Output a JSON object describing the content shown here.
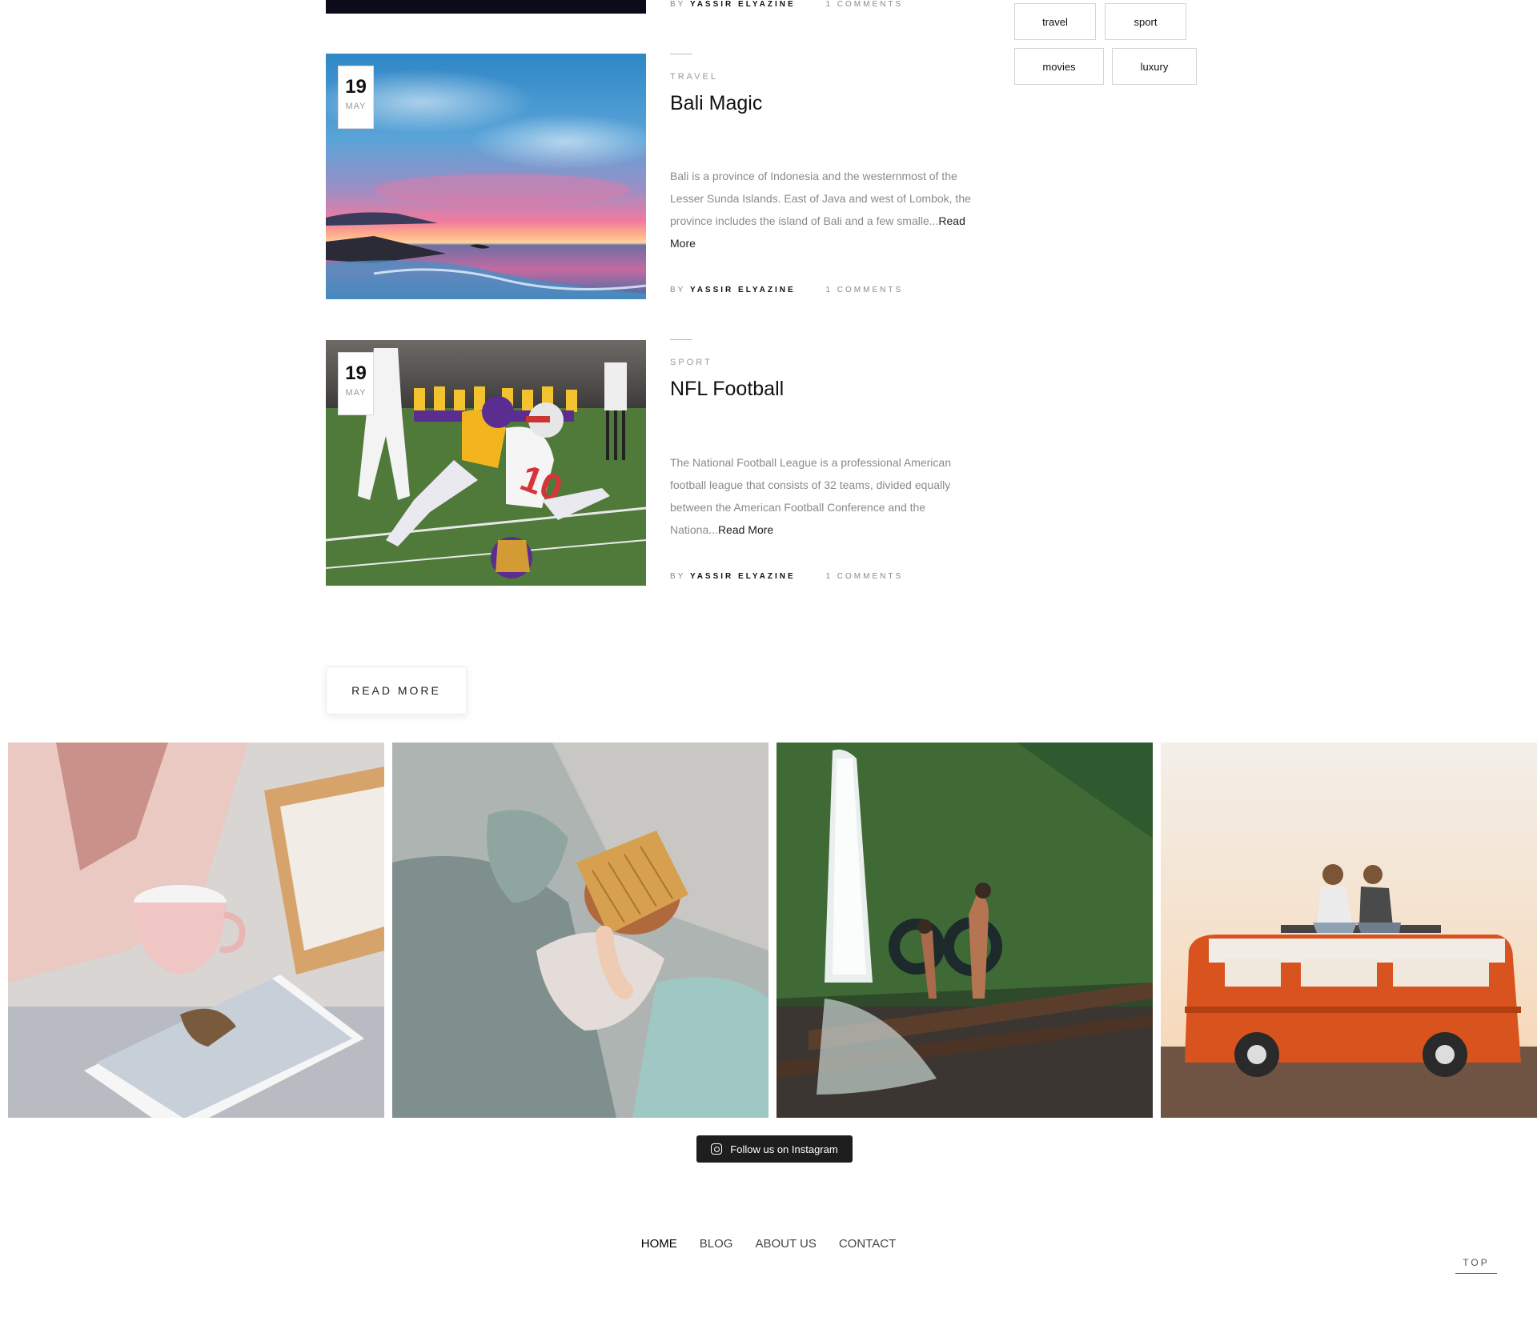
{
  "previous_post": {
    "by": "BY",
    "author": "YASSIR ELYAZINE",
    "comments": "1 COMMENTS"
  },
  "tags": [
    "travel",
    "sport",
    "movies",
    "luxury"
  ],
  "posts": [
    {
      "day": "19",
      "month": "MAY",
      "category": "TRAVEL",
      "title": "Bali Magic",
      "excerpt": "Bali is a province of Indonesia and the westernmost of the Lesser Sunda Islands. East of Java and west of Lombok, the province includes the island of Bali and a few smalle...",
      "read_more": "Read More",
      "by": "BY",
      "author": "YASSIR ELYAZINE",
      "comments": "1 COMMENTS"
    },
    {
      "day": "19",
      "month": "MAY",
      "category": "SPORT",
      "title": "NFL Football",
      "excerpt": "The National Football League is a professional American football league that consists of 32 teams, divided equally between the American Football Conference and the Nationa...",
      "read_more": "Read More",
      "by": "BY",
      "author": "YASSIR ELYAZINE",
      "comments": "1 COMMENTS"
    }
  ],
  "read_more_button": "READ MORE",
  "instagram": {
    "button_label": "Follow us on Instagram",
    "icon": "instagram-icon"
  },
  "footer": {
    "nav": [
      "HOME",
      "BLOG",
      "ABOUT US",
      "CONTACT"
    ],
    "top_label": "TOP"
  },
  "colors": {
    "dark_button": "#1e1e1e",
    "van_orange": "#d9531e"
  }
}
